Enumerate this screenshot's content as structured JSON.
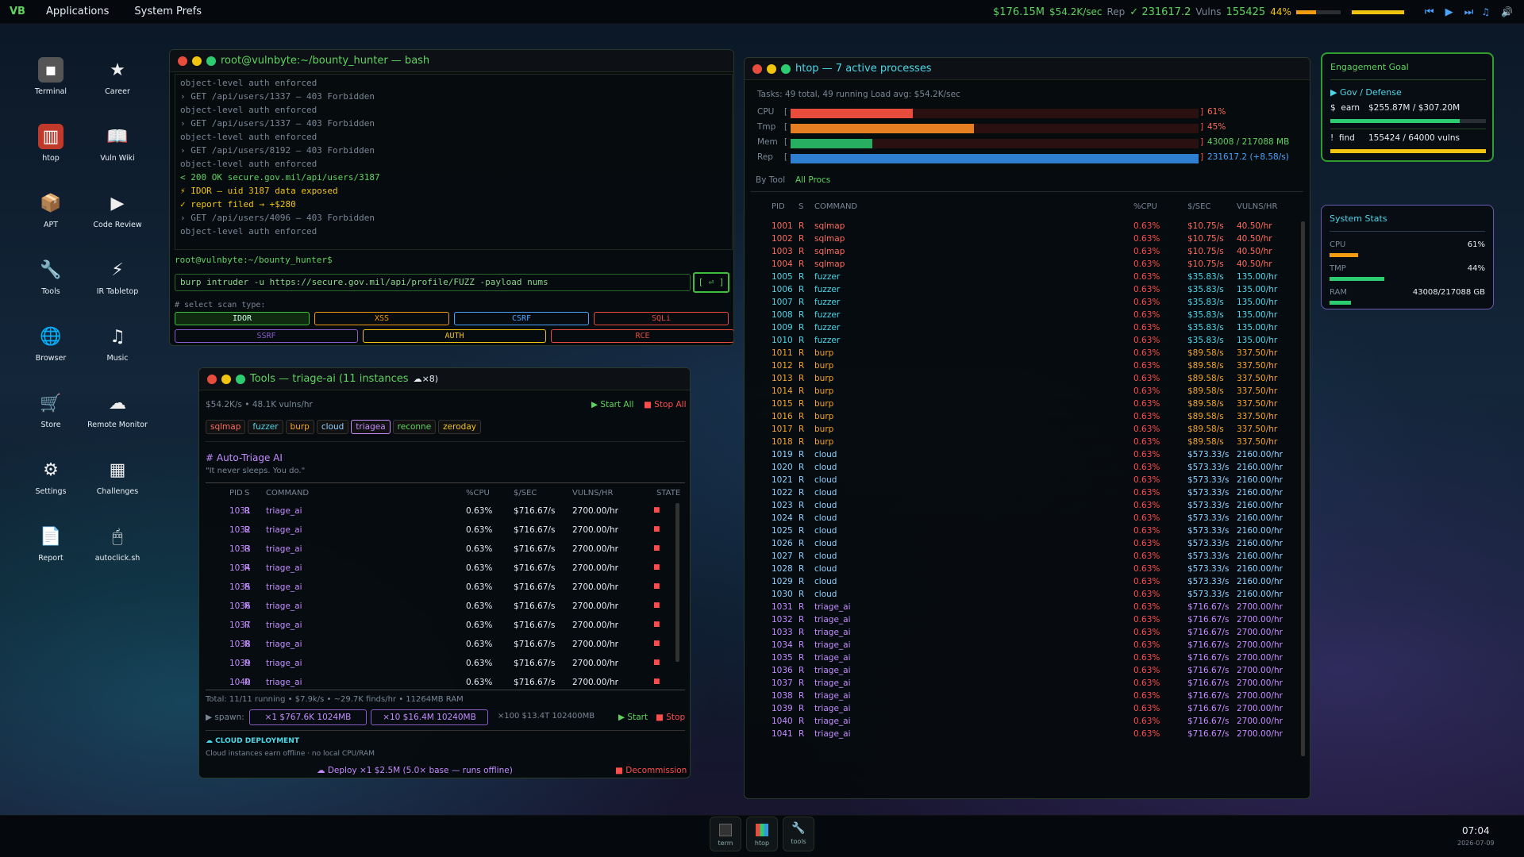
{
  "topbar": {
    "logo": "VB",
    "menu": [
      "Applications",
      "System Prefs"
    ],
    "money": "$176.15M",
    "rate": "$54.2K/sec",
    "rep_label": "Rep",
    "rep": "✓ 231617.2",
    "vulns_label": "Vulns",
    "vulns": "155425",
    "pct": "44%",
    "progress_pct": 44
  },
  "desktop": [
    {
      "label": "Terminal",
      "icon": "terminal-icon"
    },
    {
      "label": "Career",
      "icon": "star-icon"
    },
    {
      "label": "htop",
      "icon": "htop-icon"
    },
    {
      "label": "Vuln Wiki",
      "icon": "book-icon"
    },
    {
      "label": "APT",
      "icon": "package-icon"
    },
    {
      "label": "Code Review",
      "icon": "play-icon"
    },
    {
      "label": "Tools",
      "icon": "wrench-icon"
    },
    {
      "label": "IR Tabletop",
      "icon": "bolt-icon"
    },
    {
      "label": "Browser",
      "icon": "globe-icon"
    },
    {
      "label": "Music",
      "icon": "music-icon"
    },
    {
      "label": "Store",
      "icon": "cart-icon"
    },
    {
      "label": "Remote Monitor",
      "icon": "cloud-icon"
    },
    {
      "label": "Settings",
      "icon": "gear-icon"
    },
    {
      "label": "Challenges",
      "icon": "checker-icon"
    },
    {
      "label": "Report",
      "icon": "document-icon"
    },
    {
      "label": "autoclick.sh",
      "icon": "mouse-icon"
    }
  ],
  "terminal": {
    "title": "root@vulnbyte:~/bounty_hunter — bash",
    "lines": [
      {
        "t": "object-level auth enforced",
        "c": "gr"
      },
      {
        "t": "› GET /api/users/1337 — 403 Forbidden",
        "c": "gr"
      },
      {
        "t": "object-level auth enforced",
        "c": "gr"
      },
      {
        "t": "› GET /api/users/1337 — 403 Forbidden",
        "c": "gr"
      },
      {
        "t": "object-level auth enforced",
        "c": "gr"
      },
      {
        "t": "› GET /api/users/8192 — 403 Forbidden",
        "c": "gr"
      },
      {
        "t": "object-level auth enforced",
        "c": "gr"
      },
      {
        "t": "< 200 OK  secure.gov.mil/api/users/3187",
        "c": "g"
      },
      {
        "t": "  ⚡ IDOR — uid 3187 data exposed",
        "c": "y"
      },
      {
        "t": "  ✓ report filed → +$280",
        "c": "y"
      },
      {
        "t": "› GET /api/users/4096 — 403 Forbidden",
        "c": "gr"
      },
      {
        "t": "object-level auth enforced",
        "c": "gr"
      }
    ],
    "prompt": "root@vulnbyte:~/bounty_hunter$",
    "command": "burp intruder -u https://secure.gov.mil/api/profile/FUZZ -payload nums",
    "run_label": "[ ⏎ ]",
    "scan_label": "# select scan type:",
    "scan_types": [
      "IDOR",
      "XSS",
      "CSRF",
      "SQLi",
      "SSRF",
      "AUTH",
      "RCE"
    ]
  },
  "tools": {
    "title": "Tools — triage-ai (11 instances",
    "cloud": "☁×8)",
    "stats": "$54.2K/s • 48.1K vulns/hr",
    "start_all": "▶ Start All",
    "stop_all": "■ Stop All",
    "tabs": [
      "sqlmap",
      "fuzzer",
      "burp",
      "cloud",
      "triagea",
      "reconne",
      "zeroday"
    ],
    "heading": "# Auto-Triage AI",
    "quote": "\"It never sleeps. You do.\"",
    "cols": [
      "PID",
      "S",
      "COMMAND",
      "%CPU",
      "$/SEC",
      "VULNS/HR",
      "STATE"
    ],
    "rows": [
      [
        "1031",
        "R",
        "triage_ai",
        "0.63%",
        "$716.67/s",
        "2700.00/hr"
      ],
      [
        "1032",
        "R",
        "triage_ai",
        "0.63%",
        "$716.67/s",
        "2700.00/hr"
      ],
      [
        "1033",
        "R",
        "triage_ai",
        "0.63%",
        "$716.67/s",
        "2700.00/hr"
      ],
      [
        "1034",
        "R",
        "triage_ai",
        "0.63%",
        "$716.67/s",
        "2700.00/hr"
      ],
      [
        "1035",
        "R",
        "triage_ai",
        "0.63%",
        "$716.67/s",
        "2700.00/hr"
      ],
      [
        "1036",
        "R",
        "triage_ai",
        "0.63%",
        "$716.67/s",
        "2700.00/hr"
      ],
      [
        "1037",
        "R",
        "triage_ai",
        "0.63%",
        "$716.67/s",
        "2700.00/hr"
      ],
      [
        "1038",
        "R",
        "triage_ai",
        "0.63%",
        "$716.67/s",
        "2700.00/hr"
      ],
      [
        "1039",
        "R",
        "triage_ai",
        "0.63%",
        "$716.67/s",
        "2700.00/hr"
      ],
      [
        "1040",
        "R",
        "triage_ai",
        "0.63%",
        "$716.67/s",
        "2700.00/hr"
      ]
    ],
    "total": "Total: 11/11 running • $7.9k/s • ~29.7K finds/hr • 11264MB RAM",
    "spawn_label": "▶ spawn:",
    "spawn": [
      "×1  $767.6K  1024MB",
      "×10  $16.4M  10240MB",
      "×100  $13.4T  102400MB"
    ],
    "start": "▶ Start",
    "stop": "■ Stop",
    "cloud_head": "☁ CLOUD DEPLOYMENT",
    "cloud_desc": "Cloud instances earn offline · no local CPU/RAM",
    "deploy": "☁ Deploy ×1  $2.5M  (5.0× base — runs offline)",
    "decommission": "■ Decommission"
  },
  "htop": {
    "title": "htop — 7 active processes",
    "tasks": "Tasks: 49 total, 49 running    Load avg: $54.2K/sec",
    "meters": [
      {
        "label": "CPU",
        "value": "61%",
        "fill": 0.3,
        "color": "#e74c3c"
      },
      {
        "label": "Tmp",
        "value": "45%",
        "fill": 0.45,
        "color": "#e67e22"
      },
      {
        "label": "Mem",
        "value": "43008 / 217088 MB",
        "fill": 0.2,
        "color": "#27ae60"
      },
      {
        "label": "Rep",
        "value": "231617.2 (+8.58/s)",
        "fill": 1.0,
        "color": "#2f7fd0"
      }
    ],
    "by_tool": "By Tool",
    "all_procs": "All Procs",
    "cols": [
      "PID",
      "S",
      "COMMAND",
      "%CPU",
      "$/SEC",
      "VULNS/HR"
    ]
  },
  "goal": {
    "title": "Engagement Goal",
    "sub": "▶ Gov / Defense",
    "earn_label": "$  earn",
    "earn": "$255.87M / $307.20M",
    "find_label": "!  find",
    "find": "155424 / 64000 vulns",
    "earn_pct": 0.83,
    "find_pct": 1.0
  },
  "stats": {
    "title": "System Stats",
    "cpu_label": "CPU",
    "cpu": "61%",
    "tmp_label": "TMP",
    "tmp": "44%",
    "ram_label": "RAM",
    "ram": "43008/217088 GB",
    "cpu_pct": 0.61,
    "tmp_pct": 0.44,
    "ram_pct": 0.2
  },
  "dock": [
    "term",
    "htop",
    "tools"
  ],
  "clock": {
    "time": "07:04",
    "date": "2026-07-09"
  },
  "colors": {
    "sqlmap": "#ff6b5b",
    "fuzzer": "#4dd8e8",
    "burp": "#f5a623",
    "cloud": "#8fd3ff",
    "triage": "#c48cff",
    "recon": "#5fd35f"
  }
}
